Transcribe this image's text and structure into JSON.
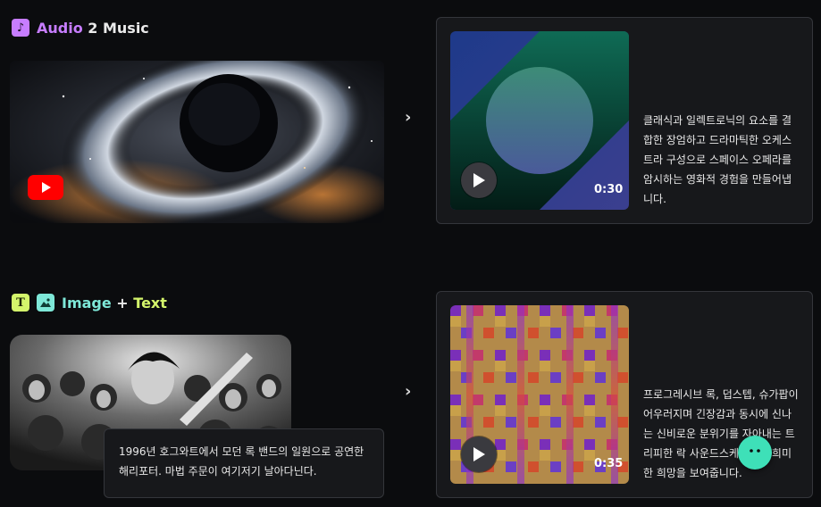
{
  "section1": {
    "title_part1": "Audio",
    "title_part2": " 2 Music",
    "icon": "music-note-icon",
    "source_icon": "youtube-icon",
    "chevron": "›",
    "result": {
      "duration": "0:30",
      "description": "클래식과 일렉트로닉의 요소를 결합한 장엄하고 드라마틱한 오케스트라 구성으로 스페이스 오페라를 암시하는 영화적 경험을 만들어냅니다."
    }
  },
  "section2": {
    "title_part1": "Image",
    "title_mid": " + ",
    "title_part2": "Text",
    "icons": [
      "text-icon",
      "image-icon"
    ],
    "caption": "1996년 호그와트에서 모던 록 밴드의 일원으로 공연한 해리포터. 마법 주문이 여기저기 날아다닌다.",
    "chevron": "›",
    "result": {
      "duration": "0:35",
      "description": "프로그레시브 록, 덥스텝, 슈가팝이 어우러지며 긴장감과 동시에 신나는 신비로운 분위기를 자아내는 트리피한 락 사운드스케이프로 희미한 희망을 보여줍니다."
    }
  },
  "colors": {
    "audio_accent": "#c77dff",
    "image_accent": "#7ee8d8",
    "text_accent": "#d4f56b",
    "chat_button": "#3ee0b8"
  }
}
